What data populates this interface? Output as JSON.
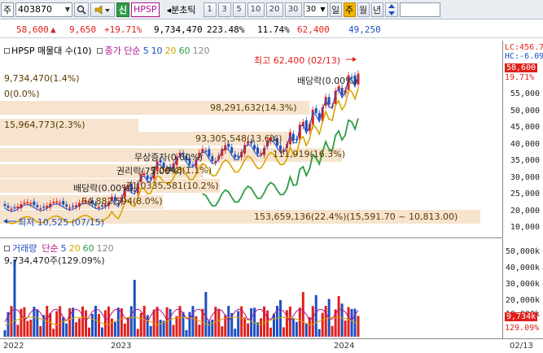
{
  "toolbar": {
    "market_select": "주",
    "code_value": "403870",
    "search_icon": "magnifier",
    "speaker_icon": "speaker",
    "new_badge": "신",
    "stock_name": "HPSP",
    "unit_prefix": "◂분초틱",
    "periods": [
      "1",
      "3",
      "5",
      "10",
      "20",
      "30"
    ],
    "period_select": "30",
    "period_day": "일",
    "period_week": "주",
    "period_month": "월",
    "period_year": "년",
    "sort_icon": "updown"
  },
  "info": {
    "price": "58,600",
    "direction": "▲",
    "change": "9,650",
    "change_pct": "+19.71%",
    "volume": "9,734,470",
    "vol_ratio": "223.48%",
    "turnover": "11.74%",
    "high": "62,400",
    "low": "49,250"
  },
  "price_legend": {
    "name": "HPSP 매물대 수(10)",
    "ma_label": "종가 단순",
    "ma_periods": [
      {
        "label": "5",
        "color": "#1d4fc2"
      },
      {
        "label": "10",
        "color": "#1d4fc2"
      },
      {
        "label": "20",
        "color": "#d9a300"
      },
      {
        "label": "60",
        "color": "#2f9b44"
      },
      {
        "label": "120",
        "color": "#888888"
      }
    ]
  },
  "price_annotations": {
    "max_label": "최고 62,400 (02/13)",
    "min_label": "최저 10,525 (07/15)",
    "left_vol": "9,734,470(1.4%)",
    "zero": "0(0.0%)",
    "dividend1": "배당락(0.00%)",
    "dividend2": "배당락(0.00%)",
    "rights": "권리락(75.00%)",
    "bonus": "무상증자(0.00%)",
    "band_labels": [
      "98,291,632(14.3%)",
      "15,964,773(2.3%)",
      "93,305,548(13.6%)",
      "111,919(16.3%)",
      "71,0335,581(10.2%)",
      "7,0948(1.1%)",
      "54,882,594(8.0%)",
      "153,659,136(22.4%)(15,591.70 ~ 10,813.00)"
    ]
  },
  "right_tags": {
    "lc": "LC:456.7",
    "hc": "HC:-6.09",
    "last_price": "58,600",
    "last_pct": "19.71%",
    "vol_last": "9,734k",
    "vol_pct": "129.09%"
  },
  "price_ticks": [
    "55,000",
    "50,000",
    "45,000",
    "40,000",
    "35,000",
    "30,000",
    "25,000",
    "20,000",
    "15,000",
    "10,000"
  ],
  "vol_legend": {
    "name": "거래량",
    "ma_label": "단순",
    "periods": [
      {
        "label": "5",
        "color": "#1d4fc2"
      },
      {
        "label": "20",
        "color": "#d9a300"
      },
      {
        "label": "60",
        "color": "#2f9b44"
      },
      {
        "label": "120",
        "color": "#888888"
      }
    ],
    "top_value": "9,734,470주(129.09%)"
  },
  "vol_ticks": [
    "50,000k",
    "40,000k",
    "30,000k",
    "20,000k",
    "10,000k"
  ],
  "dates": [
    "2022",
    "2023",
    "2024",
    "02/13"
  ]
}
